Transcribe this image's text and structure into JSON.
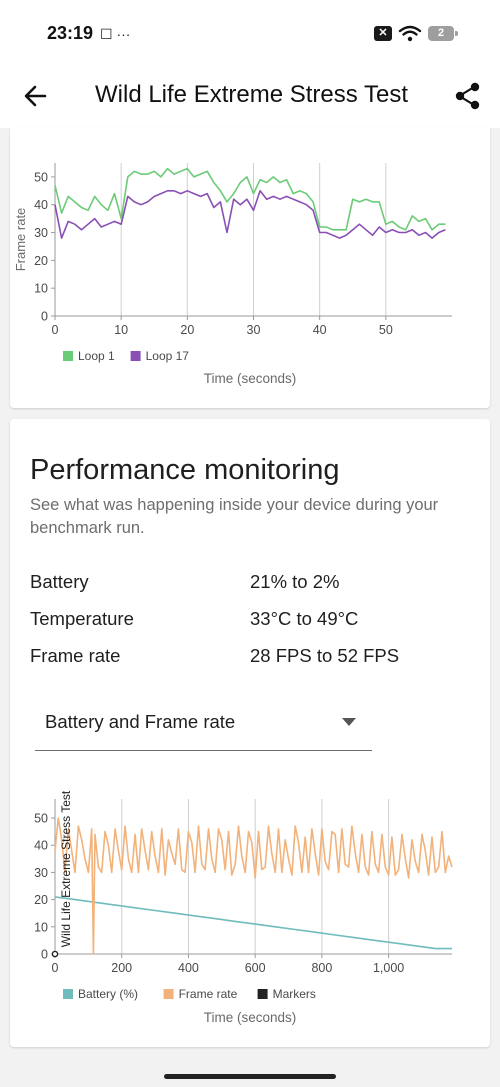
{
  "status_bar": {
    "time": "23:19",
    "left_icons": "☐ ···",
    "sim": "✕",
    "battery_level": "2"
  },
  "app_bar": {
    "title": "Wild Life Extreme Stress Test"
  },
  "performance": {
    "title": "Performance monitoring",
    "description": "See what was happening inside your device during your benchmark run.",
    "metrics": [
      {
        "label": "Battery",
        "value": "21% to 2%"
      },
      {
        "label": "Temperature",
        "value": "33°C to 49°C"
      },
      {
        "label": "Frame rate",
        "value": "28 FPS to 52 FPS"
      }
    ],
    "dropdown": {
      "selected": "Battery and Frame rate"
    }
  },
  "colors": {
    "loop1": "#6bcb77",
    "loop17": "#8a4fb5",
    "battery": "#6fbcbc",
    "frame_rate": "#f2b27a",
    "markers": "#222222"
  },
  "chart_data": [
    {
      "type": "line",
      "xlabel": "Time (seconds)",
      "ylabel": "Frame rate",
      "xlim": [
        0,
        60
      ],
      "ylim": [
        0,
        55
      ],
      "xticks": [
        0,
        10,
        20,
        30,
        40,
        50
      ],
      "yticks": [
        0,
        10,
        20,
        30,
        40,
        50
      ],
      "vertical_grid": true,
      "legend": "bottom-left",
      "series": [
        {
          "name": "Loop 1",
          "color": "#6bcb77",
          "x": [
            0,
            1,
            2,
            3,
            4,
            5,
            6,
            7,
            8,
            9,
            10,
            11,
            12,
            13,
            14,
            15,
            16,
            17,
            18,
            19,
            20,
            21,
            22,
            23,
            24,
            25,
            26,
            27,
            28,
            29,
            30,
            31,
            32,
            33,
            34,
            35,
            36,
            37,
            38,
            39,
            40,
            41,
            42,
            43,
            44,
            45,
            46,
            47,
            48,
            49,
            50,
            51,
            52,
            53,
            54,
            55,
            56,
            57,
            58,
            59
          ],
          "values": [
            47,
            37,
            43,
            41,
            39,
            38,
            43,
            40,
            38,
            44,
            35,
            50,
            52,
            51,
            51,
            52,
            50,
            53,
            51,
            52,
            53,
            50,
            51,
            52,
            48,
            45,
            41,
            44,
            48,
            50,
            44,
            49,
            48,
            50,
            48,
            49,
            44,
            45,
            44,
            41,
            32,
            32,
            31,
            31,
            31,
            42,
            41,
            42,
            41,
            41,
            33,
            34,
            32,
            31,
            36,
            34,
            35,
            31,
            33,
            33
          ]
        },
        {
          "name": "Loop 17",
          "color": "#8a4fb5",
          "x": [
            0,
            1,
            2,
            3,
            4,
            5,
            6,
            7,
            8,
            9,
            10,
            11,
            12,
            13,
            14,
            15,
            16,
            17,
            18,
            19,
            20,
            21,
            22,
            23,
            24,
            25,
            26,
            27,
            28,
            29,
            30,
            31,
            32,
            33,
            34,
            35,
            36,
            37,
            38,
            39,
            40,
            41,
            42,
            43,
            44,
            45,
            46,
            47,
            48,
            49,
            50,
            51,
            52,
            53,
            54,
            55,
            56,
            57,
            58,
            59
          ],
          "values": [
            40,
            28,
            34,
            33,
            31,
            33,
            35,
            32,
            33,
            34,
            33,
            43,
            41,
            40,
            41,
            43,
            44,
            45,
            45,
            44,
            45,
            44,
            43,
            44,
            39,
            41,
            30,
            42,
            40,
            42,
            38,
            45,
            42,
            43,
            42,
            43,
            42,
            41,
            40,
            38,
            30,
            30,
            29,
            28,
            29,
            31,
            33,
            31,
            29,
            32,
            30,
            31,
            30,
            30,
            31,
            29,
            30,
            28,
            30,
            31
          ]
        }
      ]
    },
    {
      "type": "line",
      "title": "Wild Life Extreme Stress Test",
      "xlabel": "Time (seconds)",
      "xlim": [
        0,
        1190
      ],
      "ylim": [
        0,
        57
      ],
      "xticks": [
        0,
        200,
        400,
        600,
        800,
        1000
      ],
      "xtick_labels": [
        "0",
        "200",
        "400",
        "600",
        "800",
        "1,000"
      ],
      "yticks": [
        0,
        10,
        20,
        30,
        40,
        50
      ],
      "vertical_grid": true,
      "legend": "bottom-left",
      "legend_entries": [
        "Battery (%)",
        "Frame rate",
        "Markers"
      ],
      "markers": [
        {
          "x": 0,
          "y": 0
        }
      ],
      "series": [
        {
          "name": "Battery (%)",
          "color": "#6fbcbc",
          "x": [
            0,
            60,
            120,
            180,
            240,
            300,
            360,
            420,
            480,
            540,
            600,
            660,
            720,
            780,
            840,
            900,
            960,
            1020,
            1080,
            1140,
            1190
          ],
          "values": [
            21,
            20,
            19,
            18,
            17,
            16,
            15,
            14,
            13,
            12,
            11,
            10,
            9,
            8,
            7,
            6,
            5,
            4,
            3,
            2,
            2
          ]
        },
        {
          "name": "Frame rate",
          "color": "#f2b27a",
          "x": [
            0,
            10,
            20,
            30,
            40,
            50,
            60,
            70,
            80,
            90,
            100,
            110,
            115,
            120,
            130,
            140,
            150,
            160,
            170,
            180,
            190,
            200,
            210,
            220,
            230,
            240,
            250,
            260,
            270,
            280,
            290,
            300,
            310,
            320,
            330,
            340,
            350,
            360,
            370,
            380,
            390,
            400,
            410,
            420,
            430,
            440,
            450,
            460,
            470,
            480,
            490,
            500,
            510,
            520,
            530,
            540,
            550,
            560,
            570,
            580,
            590,
            600,
            610,
            620,
            630,
            640,
            650,
            660,
            670,
            680,
            690,
            700,
            710,
            720,
            730,
            740,
            750,
            760,
            770,
            780,
            790,
            800,
            810,
            820,
            830,
            840,
            850,
            860,
            870,
            880,
            890,
            900,
            910,
            920,
            930,
            940,
            950,
            960,
            970,
            980,
            990,
            1000,
            1010,
            1020,
            1030,
            1040,
            1050,
            1060,
            1070,
            1080,
            1090,
            1100,
            1110,
            1120,
            1130,
            1140,
            1150,
            1160,
            1170,
            1180,
            1190
          ],
          "values": [
            38,
            50,
            42,
            30,
            46,
            38,
            30,
            47,
            42,
            35,
            30,
            46,
            0,
            44,
            32,
            30,
            45,
            40,
            30,
            46,
            38,
            31,
            47,
            35,
            30,
            44,
            30,
            46,
            38,
            31,
            45,
            36,
            30,
            46,
            29,
            42,
            37,
            33,
            46,
            31,
            30,
            45,
            41,
            30,
            47,
            33,
            31,
            46,
            35,
            30,
            46,
            42,
            31,
            45,
            29,
            33,
            47,
            36,
            30,
            45,
            41,
            28,
            45,
            31,
            32,
            47,
            37,
            30,
            46,
            30,
            42,
            35,
            29,
            47,
            41,
            30,
            43,
            30,
            46,
            37,
            29,
            46,
            34,
            31,
            45,
            44,
            30,
            46,
            33,
            32,
            47,
            37,
            30,
            44,
            32,
            29,
            45,
            33,
            30,
            44,
            32,
            29,
            43,
            29,
            31,
            44,
            35,
            28,
            42,
            34,
            30,
            44,
            38,
            29,
            43,
            30,
            32,
            45,
            30,
            36,
            32
          ]
        }
      ]
    }
  ]
}
